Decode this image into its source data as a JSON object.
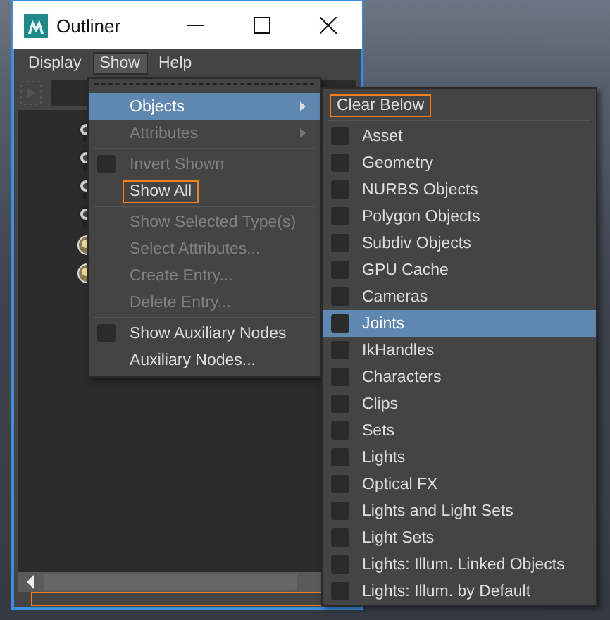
{
  "window": {
    "title": "Outliner"
  },
  "menu_bar": [
    {
      "label": "Display",
      "selected": false
    },
    {
      "label": "Show",
      "selected": true
    },
    {
      "label": "Help",
      "selected": false
    }
  ],
  "outliner_items": [
    {
      "kind": "camera"
    },
    {
      "kind": "camera"
    },
    {
      "kind": "camera"
    },
    {
      "kind": "camera"
    },
    {
      "kind": "sphere"
    },
    {
      "kind": "sphere"
    }
  ],
  "show_menu": [
    {
      "kind": "item",
      "label": "Objects",
      "submenu": true,
      "selected": true,
      "disabled": false,
      "highlighted": false
    },
    {
      "kind": "item",
      "label": "Attributes",
      "submenu": true,
      "selected": false,
      "disabled": true,
      "highlighted": false
    },
    {
      "kind": "separator"
    },
    {
      "kind": "checkbox",
      "label": "Invert Shown",
      "checked": false,
      "selected": false,
      "disabled": true,
      "highlighted": false
    },
    {
      "kind": "item",
      "label": "Show All",
      "submenu": false,
      "selected": false,
      "disabled": false,
      "highlighted": true
    },
    {
      "kind": "separator"
    },
    {
      "kind": "item",
      "label": "Show Selected Type(s)",
      "submenu": false,
      "selected": false,
      "disabled": true,
      "highlighted": false
    },
    {
      "kind": "item",
      "label": "Select Attributes...",
      "submenu": false,
      "selected": false,
      "disabled": true,
      "highlighted": false
    },
    {
      "kind": "item",
      "label": "Create Entry...",
      "submenu": false,
      "selected": false,
      "disabled": true,
      "highlighted": false
    },
    {
      "kind": "item",
      "label": "Delete Entry...",
      "submenu": false,
      "selected": false,
      "disabled": true,
      "highlighted": false
    },
    {
      "kind": "separator"
    },
    {
      "kind": "checkbox",
      "label": "Show Auxiliary Nodes",
      "checked": false,
      "selected": false,
      "disabled": false,
      "highlighted": false
    },
    {
      "kind": "item",
      "label": "Auxiliary Nodes...",
      "submenu": false,
      "selected": false,
      "disabled": false,
      "highlighted": false
    }
  ],
  "objects_submenu": [
    {
      "kind": "item",
      "label": "Clear Below",
      "selected": false,
      "highlighted": true
    },
    {
      "kind": "separator"
    },
    {
      "kind": "checkbox",
      "label": "Asset",
      "checked": false,
      "selected": false
    },
    {
      "kind": "checkbox",
      "label": "Geometry",
      "checked": false,
      "selected": false
    },
    {
      "kind": "checkbox",
      "label": "NURBS Objects",
      "checked": false,
      "selected": false
    },
    {
      "kind": "checkbox",
      "label": "Polygon Objects",
      "checked": false,
      "selected": false
    },
    {
      "kind": "checkbox",
      "label": "Subdiv Objects",
      "checked": false,
      "selected": false
    },
    {
      "kind": "checkbox",
      "label": "GPU Cache",
      "checked": false,
      "selected": false
    },
    {
      "kind": "checkbox",
      "label": "Cameras",
      "checked": false,
      "selected": false
    },
    {
      "kind": "checkbox",
      "label": "Joints",
      "checked": false,
      "selected": true
    },
    {
      "kind": "checkbox",
      "label": "IkHandles",
      "checked": false,
      "selected": false
    },
    {
      "kind": "checkbox",
      "label": "Characters",
      "checked": false,
      "selected": false
    },
    {
      "kind": "checkbox",
      "label": "Clips",
      "checked": false,
      "selected": false
    },
    {
      "kind": "checkbox",
      "label": "Sets",
      "checked": false,
      "selected": false
    },
    {
      "kind": "checkbox",
      "label": "Lights",
      "checked": false,
      "selected": false
    },
    {
      "kind": "checkbox",
      "label": "Optical FX",
      "checked": false,
      "selected": false
    },
    {
      "kind": "checkbox",
      "label": "Lights and Light Sets",
      "checked": false,
      "selected": false
    },
    {
      "kind": "checkbox",
      "label": "Light Sets",
      "checked": false,
      "selected": false
    },
    {
      "kind": "checkbox",
      "label": "Lights: Illum. Linked Objects",
      "checked": false,
      "selected": false
    },
    {
      "kind": "checkbox",
      "label": "Lights: Illum. by Default",
      "checked": false,
      "selected": false
    }
  ],
  "resize_bar": {
    "highlighted": true
  }
}
